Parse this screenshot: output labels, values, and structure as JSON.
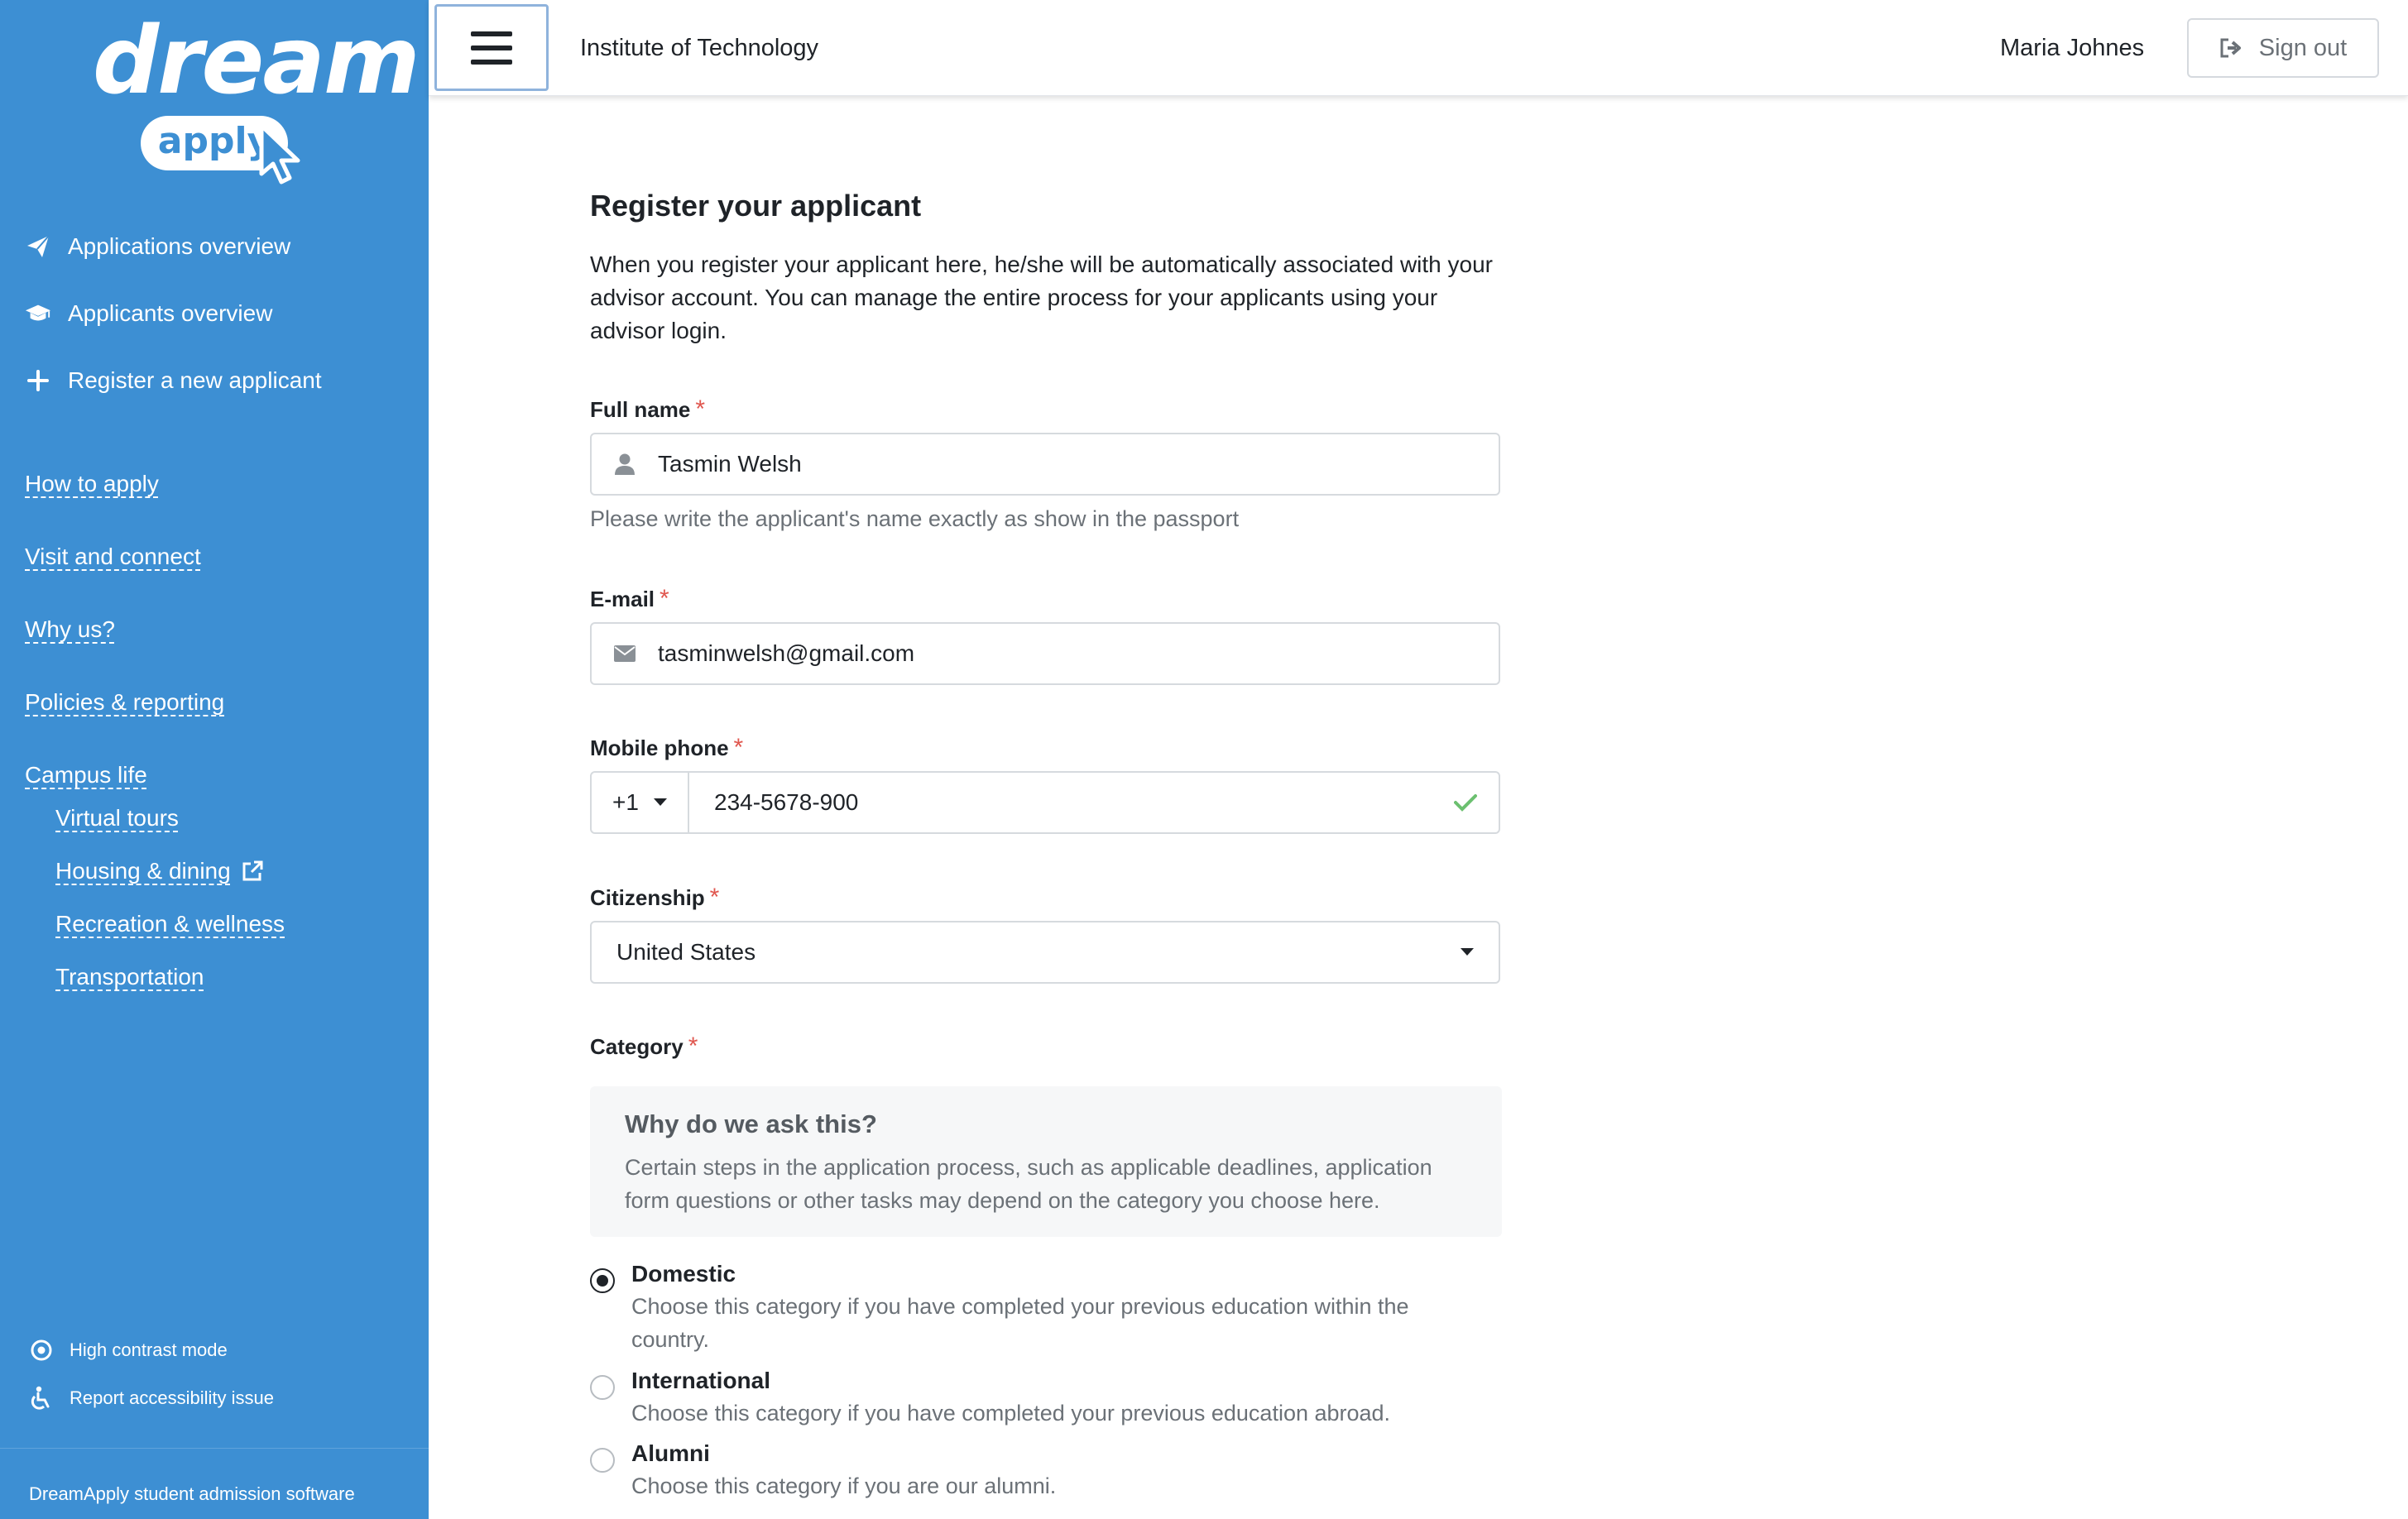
{
  "logo": {
    "word": "dream",
    "pill": "apply"
  },
  "sidebar": {
    "main_items": [
      {
        "label": "Applications overview",
        "icon": "paper-plane-icon"
      },
      {
        "label": "Applicants overview",
        "icon": "graduation-cap-icon"
      },
      {
        "label": "Register a new applicant",
        "icon": "plus-icon"
      }
    ],
    "links": [
      "How to apply",
      "Visit and connect",
      "Why us?",
      "Policies & reporting",
      "Campus life"
    ],
    "sub_links": [
      "Virtual tours",
      "Housing & dining",
      "Recreation & wellness",
      "Transportation"
    ],
    "bottom": [
      {
        "label": "High contrast mode",
        "icon": "contrast-icon"
      },
      {
        "label": "Report accessibility issue",
        "icon": "accessibility-icon"
      }
    ],
    "footer": "DreamApply student admission software"
  },
  "topbar": {
    "institute": "Institute of Technology",
    "user": "Maria Johnes",
    "signout_label": "Sign out"
  },
  "form": {
    "title": "Register your applicant",
    "intro": "When you register your applicant here, he/she will be automatically associated with your advisor account. You can manage the entire process for your applicants using your advisor login.",
    "required_mark": "*",
    "fullname": {
      "label": "Full name",
      "value": "Tasmin Welsh",
      "help": "Please write the applicant's name exactly as show in the passport"
    },
    "email": {
      "label": "E-mail",
      "value": "tasminwelsh@gmail.com"
    },
    "phone": {
      "label": "Mobile phone",
      "code": "+1",
      "value": "234-5678-900"
    },
    "citizenship": {
      "label": "Citizenship",
      "value": "United States"
    },
    "category": {
      "label": "Category",
      "info_title": "Why do we ask this?",
      "info_body": "Certain steps in the application process, such as applicable deadlines, application form questions or other tasks may depend on the category you choose here.",
      "options": [
        {
          "title": "Domestic",
          "desc": "Choose this category if you have completed your previous education within the country.",
          "selected": true
        },
        {
          "title": "International",
          "desc": "Choose this category if you have completed your previous education abroad.",
          "selected": false
        },
        {
          "title": "Alumni",
          "desc": "Choose this category if you are our alumni.",
          "selected": false
        }
      ]
    }
  },
  "colors": {
    "sidebar_bg": "#3d8fd3",
    "required": "#e0574f",
    "valid_check": "#6cc070"
  }
}
